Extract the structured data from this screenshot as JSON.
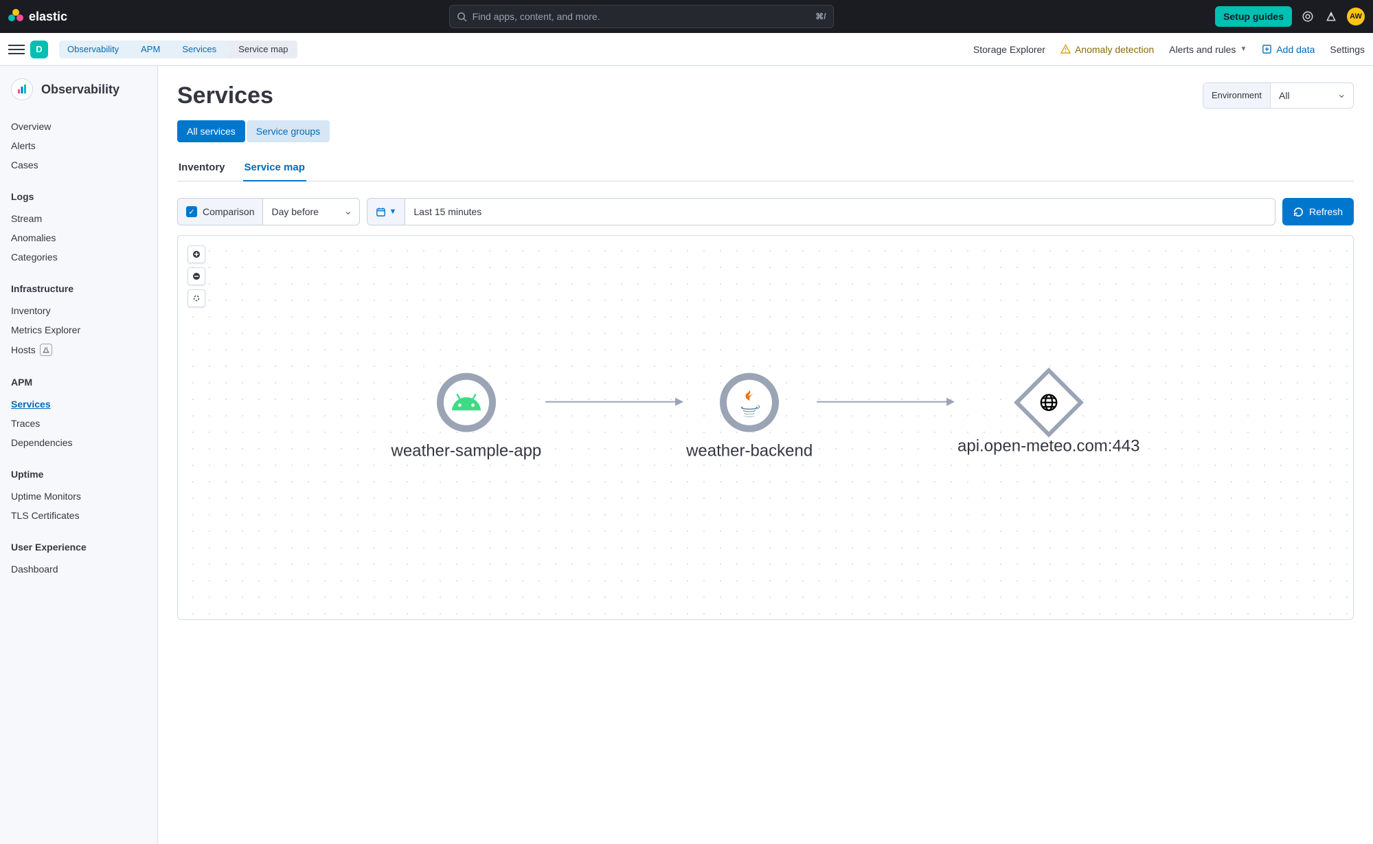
{
  "brand": "elastic",
  "search_placeholder": "Find apps, content, and more.",
  "search_shortcut": "⌘/",
  "setup_guides": "Setup guides",
  "avatar_initials": "AW",
  "space_initial": "D",
  "breadcrumbs": {
    "items": [
      "Observability",
      "APM",
      "Services",
      "Service map"
    ]
  },
  "subbar": {
    "storage": "Storage Explorer",
    "anomaly": "Anomaly detection",
    "alerts": "Alerts and rules",
    "add_data": "Add data",
    "settings": "Settings"
  },
  "sidebar": {
    "title": "Observability",
    "top": [
      "Overview",
      "Alerts",
      "Cases"
    ],
    "groups": [
      {
        "title": "Logs",
        "items": [
          "Stream",
          "Anomalies",
          "Categories"
        ]
      },
      {
        "title": "Infrastructure",
        "items": [
          "Inventory",
          "Metrics Explorer",
          "Hosts"
        ]
      },
      {
        "title": "APM",
        "items": [
          "Services",
          "Traces",
          "Dependencies"
        ]
      },
      {
        "title": "Uptime",
        "items": [
          "Uptime Monitors",
          "TLS Certificates"
        ]
      },
      {
        "title": "User Experience",
        "items": [
          "Dashboard"
        ]
      }
    ],
    "active": "Services",
    "beta_item": "Hosts"
  },
  "page": {
    "title": "Services",
    "env_label": "Environment",
    "env_value": "All",
    "pills": {
      "all": "All services",
      "groups": "Service groups"
    },
    "tabs": {
      "inventory": "Inventory",
      "map": "Service map"
    },
    "comparison_label": "Comparison",
    "comparison_value": "Day before",
    "time_range": "Last 15 minutes",
    "refresh": "Refresh"
  },
  "map": {
    "nodes": [
      {
        "label": "weather-sample-app",
        "type": "android"
      },
      {
        "label": "weather-backend",
        "type": "java"
      },
      {
        "label": "api.open-meteo.com:443",
        "type": "external"
      }
    ]
  }
}
